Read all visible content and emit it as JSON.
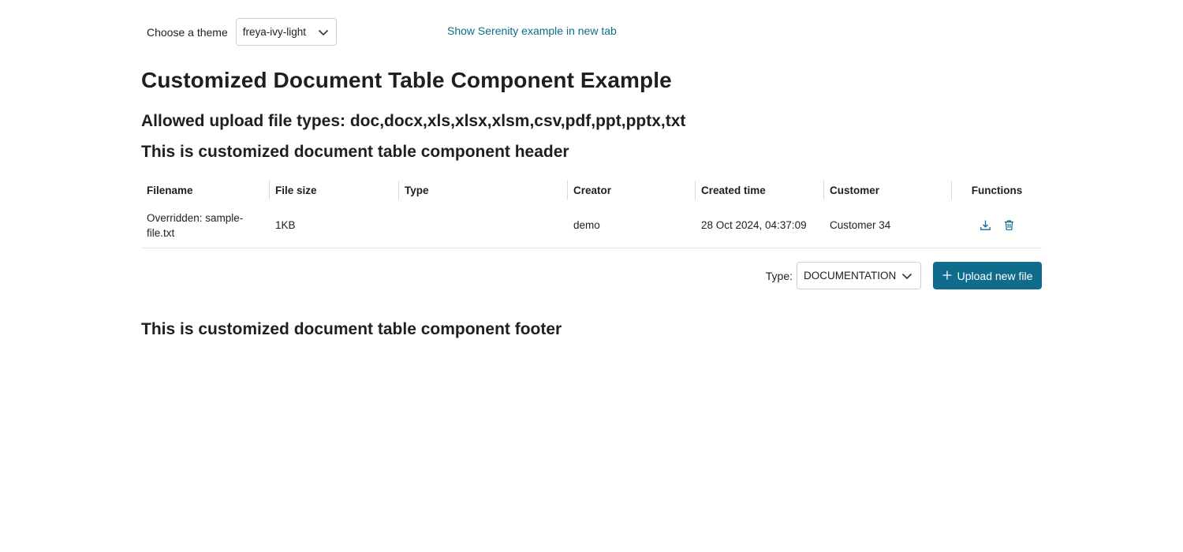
{
  "theme_bar": {
    "label": "Choose a theme",
    "selected": "freya-ivy-light",
    "chevron_icon": "chevron-down-icon"
  },
  "serenity_link": "Show Serenity example in new tab",
  "page_title": "Customized Document Table Component Example",
  "allowed_types": "Allowed upload file types: doc,docx,xls,xlsx,xlsm,csv,pdf,ppt,pptx,txt",
  "table_header_text": "This is customized document table component header",
  "table": {
    "columns": [
      "Filename",
      "File size",
      "Type",
      "Creator",
      "Created time",
      "Customer",
      "Functions"
    ],
    "rows": [
      {
        "filename": "Overridden: sample-file.txt",
        "size": "1KB",
        "type": "",
        "creator": "demo",
        "created": "28 Oct 2024, 04:37:09",
        "customer": "Customer 34",
        "download_icon": "download-icon",
        "delete_icon": "trash-icon"
      }
    ]
  },
  "upload": {
    "type_label": "Type:",
    "type_selected": "DOCUMENTATION",
    "button_label": "Upload new file",
    "button_icon": "plus-icon"
  },
  "table_footer_text": "This is customized document table component footer",
  "colors": {
    "accent": "#0f6c8c",
    "text": "#1f1f1f",
    "border": "#cfcfcf"
  }
}
